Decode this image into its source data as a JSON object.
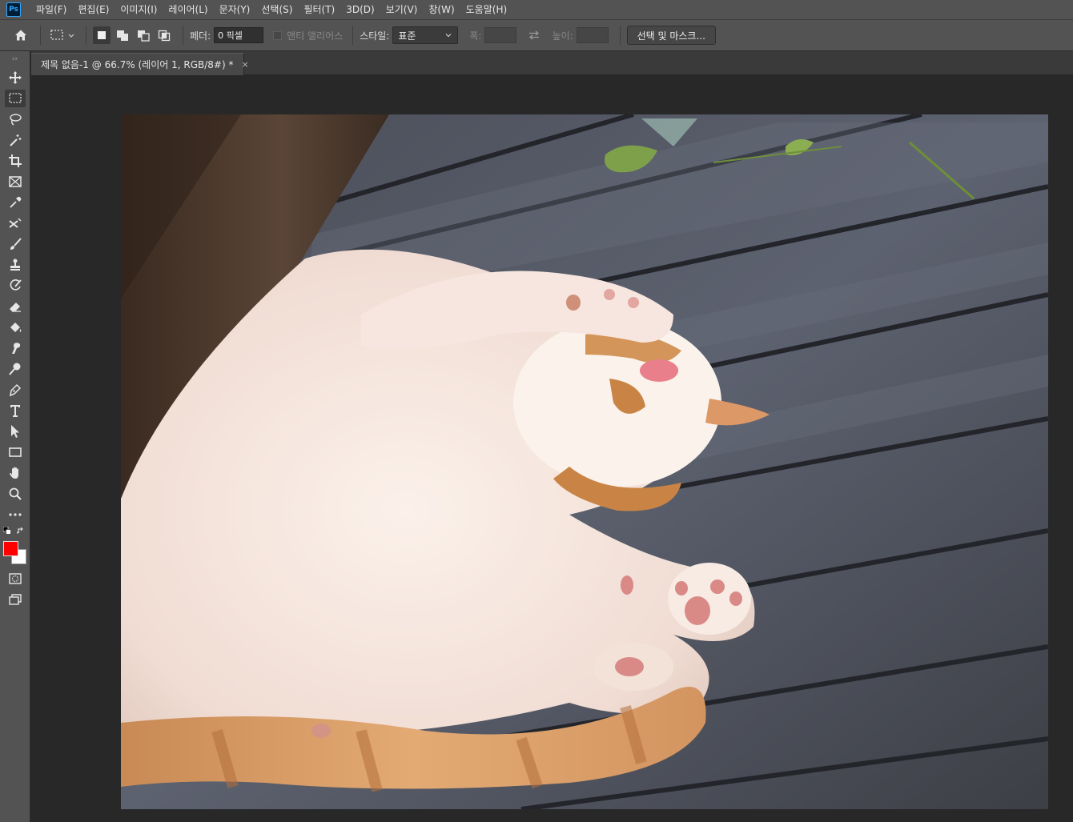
{
  "app": {
    "logo": "Ps"
  },
  "menu": [
    "파일(F)",
    "편집(E)",
    "이미지(I)",
    "레이어(L)",
    "문자(Y)",
    "선택(S)",
    "필터(T)",
    "3D(D)",
    "보기(V)",
    "창(W)",
    "도움말(H)"
  ],
  "options": {
    "feather_label": "페더:",
    "feather_value": "0 픽셀",
    "antialias_label": "앤티 앨리어스",
    "style_label": "스타일:",
    "style_value": "표준",
    "width_label": "폭:",
    "height_label": "높이:",
    "select_mask_label": "선택 및 마스크..."
  },
  "document": {
    "tab_title": "제목 없음-1 @ 66.7% (레이어 1, RGB/8#) *",
    "close_glyph": "×"
  },
  "colors": {
    "foreground": "#ff0000",
    "background": "#ffffff",
    "accent": "#31a8ff"
  },
  "tools": [
    "move-icon",
    "marquee-icon",
    "lasso-icon",
    "magic-wand-icon",
    "crop-icon",
    "frame-icon",
    "eyedropper-icon",
    "healing-icon",
    "brush-icon",
    "stamp-icon",
    "history-brush-icon",
    "eraser-icon",
    "paint-bucket-icon",
    "smudge-icon",
    "dodge-icon",
    "pen-icon",
    "type-icon",
    "path-select-icon",
    "rectangle-icon",
    "hand-icon",
    "zoom-icon",
    "more-tools-icon",
    "quick-mask-icon",
    "screen-mode-icon"
  ]
}
